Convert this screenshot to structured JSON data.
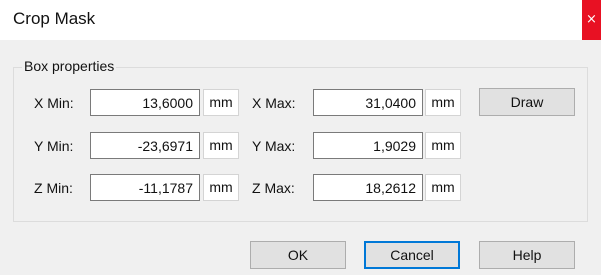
{
  "window": {
    "title": "Crop Mask",
    "close_glyph": "×"
  },
  "group": {
    "title": "Box properties"
  },
  "fields": {
    "xmin": {
      "label": "X Min:",
      "value": "13,6000",
      "unit": "mm"
    },
    "xmax": {
      "label": "X Max:",
      "value": "31,0400",
      "unit": "mm"
    },
    "ymin": {
      "label": "Y Min:",
      "value": "-23,6971",
      "unit": "mm"
    },
    "ymax": {
      "label": "Y Max:",
      "value": "1,9029",
      "unit": "mm"
    },
    "zmin": {
      "label": "Z Min:",
      "value": "-11,1787",
      "unit": "mm"
    },
    "zmax": {
      "label": "Z Max:",
      "value": "18,2612",
      "unit": "mm"
    }
  },
  "buttons": {
    "draw": "Draw",
    "ok": "OK",
    "cancel": "Cancel",
    "help": "Help"
  },
  "colors": {
    "close_bg": "#e81123",
    "default_button_border": "#0078d7"
  }
}
